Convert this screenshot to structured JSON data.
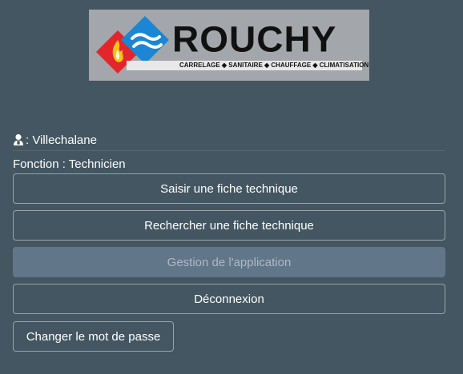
{
  "logo": {
    "brand": "ROUCHY",
    "tagline": "CARRELAGE ◆ SANITAIRE ◆ CHAUFFAGE ◆ CLIMATISATION",
    "colors": {
      "red": "#e3262a",
      "blue": "#1a86d4",
      "yellow": "#f6c21c",
      "background": "#a3a6aa"
    }
  },
  "user": {
    "icon": "user-icon",
    "text": ": Villechalane"
  },
  "fonction": {
    "text": "Fonction : Technicien"
  },
  "buttons": {
    "saisir": "Saisir une fiche technique",
    "rechercher": "Rechercher une fiche technique",
    "gestion": "Gestion de l'application",
    "deconnexion": "Déconnexion",
    "changer_mdp": "Changer le mot de passe"
  },
  "theme": {
    "background": "#435661",
    "disabled_button": "#627689"
  }
}
